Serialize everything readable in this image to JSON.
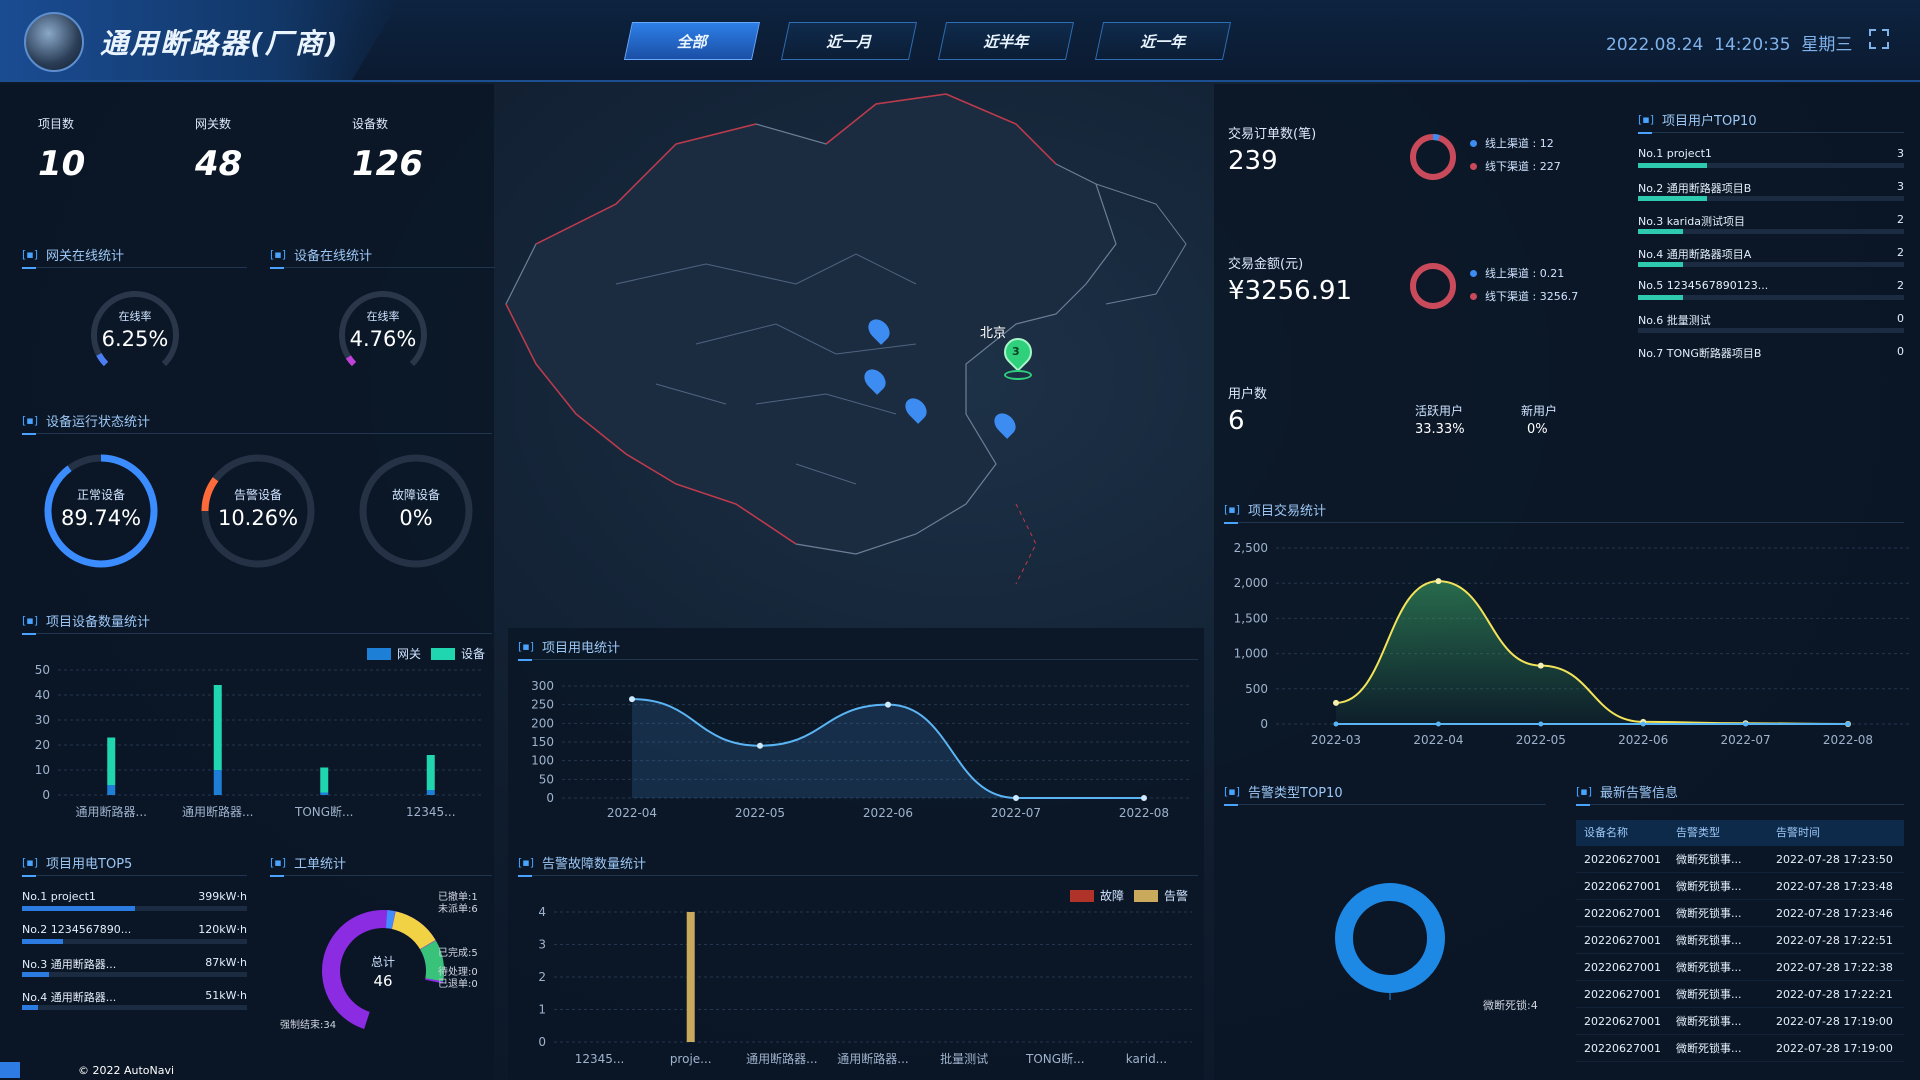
{
  "header": {
    "title": "通用断路器(厂商)",
    "date": "2022.08.24",
    "time": "14:20:35",
    "weekday": "星期三",
    "nav": [
      "全部",
      "近一月",
      "近半年",
      "近一年"
    ],
    "active_nav": 0
  },
  "summary": {
    "projects_label": "项目数",
    "projects": "10",
    "gateways_label": "网关数",
    "gateways": "48",
    "devices_label": "设备数",
    "devices": "126"
  },
  "gateway_online": {
    "title": "网关在线统计",
    "label": "在线率",
    "rate": "6.25%",
    "value": 0.0625
  },
  "device_online": {
    "title": "设备在线统计",
    "label": "在线率",
    "rate": "4.76%",
    "value": 0.0476
  },
  "device_status": {
    "title": "设备运行状态统计",
    "items": [
      {
        "label": "正常设备",
        "value": "89.74%",
        "frac": 0.8974,
        "color": "#3b8cff"
      },
      {
        "label": "告警设备",
        "value": "10.26%",
        "frac": 0.1026,
        "color": "#ff6a3a"
      },
      {
        "label": "故障设备",
        "value": "0%",
        "frac": 0,
        "color": "#888888"
      }
    ]
  },
  "project_device_chart": {
    "title": "项目设备数量统计",
    "legend": [
      "网关",
      "设备"
    ],
    "ylabels": [
      "50",
      "40",
      "30",
      "20",
      "10",
      "0"
    ]
  },
  "power_top5": {
    "title": "项目用电TOP5",
    "rows": [
      {
        "name": "No.1 project1",
        "value": "399kW·h",
        "frac": 1.0
      },
      {
        "name": "No.2 1234567890...",
        "value": "120kW·h",
        "frac": 0.3
      },
      {
        "name": "No.3 通用断路器...",
        "value": "87kW·h",
        "frac": 0.22
      },
      {
        "name": "No.4 通用断路器...",
        "value": "51kW·h",
        "frac": 0.13
      }
    ]
  },
  "work_orders": {
    "title": "工单统计",
    "center_label": "总计",
    "total": "46",
    "labels": [
      "已撤单:1",
      "未派单:6",
      "已完成:5",
      "待处理:0",
      "已退单:0",
      "强制结束:34"
    ]
  },
  "map": {
    "beijing_label": "北京",
    "cluster_count": "3",
    "credit": "© 2022 AutoNavi"
  },
  "power_stats": {
    "title": "项目用电统计",
    "ylabels": [
      "300",
      "250",
      "200",
      "150",
      "100",
      "50",
      "0"
    ]
  },
  "alarm_fault": {
    "title": "告警故障数量统计",
    "legend": [
      "故障",
      "告警"
    ],
    "ylabels": [
      "4",
      "3",
      "2",
      "1",
      "0"
    ]
  },
  "orders": {
    "count_label": "交易订单数(笔)",
    "count": "239",
    "online": "线上渠道 : 12",
    "offline": "线下渠道 : 227",
    "amount_label": "交易金额(元)",
    "amount": "¥3256.91",
    "amount_online": "线上渠道 : 0.21",
    "amount_offline": "线下渠道 : 3256.7",
    "users_label": "用户数",
    "users": "6",
    "active_label": "活跃用户",
    "active": "33.33%",
    "new_label": "新用户",
    "new": "0%"
  },
  "user_top10": {
    "title": "项目用户TOP10",
    "rows": [
      {
        "name": "No.1 project1",
        "value": "3",
        "frac": 1.0
      },
      {
        "name": "No.2 通用断路器项目B",
        "value": "3",
        "frac": 1.0
      },
      {
        "name": "No.3 karida测试项目",
        "value": "2",
        "frac": 0.67
      },
      {
        "name": "No.4 通用断路器项目A",
        "value": "2",
        "frac": 0.67
      },
      {
        "name": "No.5 1234567890123...",
        "value": "2",
        "frac": 0.67
      },
      {
        "name": "No.6 批量测试",
        "value": "0",
        "frac": 0
      },
      {
        "name": "No.7 TONG断路器项目B",
        "value": "0",
        "frac": 0
      }
    ]
  },
  "trade_stats": {
    "title": "项目交易统计",
    "ylabels": [
      "2,500",
      "2,000",
      "1,500",
      "1,000",
      "500",
      "0"
    ]
  },
  "alarm_type": {
    "title": "告警类型TOP10",
    "label": "微断死锁:4"
  },
  "latest_alarms": {
    "title": "最新告警信息",
    "headers": [
      "设备名称",
      "告警类型",
      "告警时间"
    ],
    "rows": [
      [
        "20220627001",
        "微断死锁事...",
        "2022-07-28 17:23:50"
      ],
      [
        "20220627001",
        "微断死锁事...",
        "2022-07-28 17:23:48"
      ],
      [
        "20220627001",
        "微断死锁事...",
        "2022-07-28 17:23:46"
      ],
      [
        "20220627001",
        "微断死锁事...",
        "2022-07-28 17:22:51"
      ],
      [
        "20220627001",
        "微断死锁事...",
        "2022-07-28 17:22:38"
      ],
      [
        "20220627001",
        "微断死锁事...",
        "2022-07-28 17:22:21"
      ],
      [
        "20220627001",
        "微断死锁事...",
        "2022-07-28 17:19:00"
      ],
      [
        "20220627001",
        "微断死锁事...",
        "2022-07-28 17:19:00"
      ]
    ]
  },
  "chart_data": [
    {
      "type": "bar",
      "title": "项目设备数量统计",
      "categories": [
        "通用断路器...",
        "通用断路器...",
        "TONG断...",
        "12345..."
      ],
      "series": [
        {
          "name": "网关",
          "values": [
            4,
            10,
            1,
            2
          ]
        },
        {
          "name": "设备",
          "values": [
            19,
            34,
            10,
            14
          ]
        }
      ],
      "ylim": [
        0,
        50
      ]
    },
    {
      "type": "line",
      "title": "项目用电统计",
      "x": [
        "2022-04",
        "2022-05",
        "2022-06",
        "2022-07",
        "2022-08"
      ],
      "series": [
        {
          "values": [
            265,
            140,
            250,
            0,
            0
          ]
        }
      ],
      "ylim": [
        0,
        300
      ]
    },
    {
      "type": "bar",
      "title": "告警故障数量统计",
      "categories": [
        "12345...",
        "proje...",
        "通用断路器...",
        "通用断路器...",
        "批量测试",
        "TONG断...",
        "karid..."
      ],
      "series": [
        {
          "name": "故障",
          "values": [
            0,
            0,
            0,
            0,
            0,
            0,
            0
          ]
        },
        {
          "name": "告警",
          "values": [
            0,
            4,
            0,
            0,
            0,
            0,
            0
          ]
        }
      ],
      "ylim": [
        0,
        4
      ]
    },
    {
      "type": "area",
      "title": "项目交易统计",
      "x": [
        "2022-03",
        "2022-04",
        "2022-05",
        "2022-06",
        "2022-07",
        "2022-08"
      ],
      "series": [
        {
          "values": [
            300,
            2030,
            830,
            30,
            10,
            0
          ]
        },
        {
          "values": [
            0,
            0,
            0,
            0,
            0,
            0
          ]
        }
      ],
      "ylim": [
        0,
        2500
      ]
    },
    {
      "type": "pie",
      "title": "告警类型TOP10",
      "slices": [
        {
          "label": "微断死锁",
          "value": 4
        }
      ]
    }
  ],
  "colors": {
    "accent": "#4aa3ff",
    "gateway_bar": "#1e7fd6",
    "device_bar": "#1fd6b0",
    "fault": "#b0332a",
    "alarm": "#c9a95b",
    "line": "#5bb5f5",
    "trade": "#f3e35a"
  }
}
